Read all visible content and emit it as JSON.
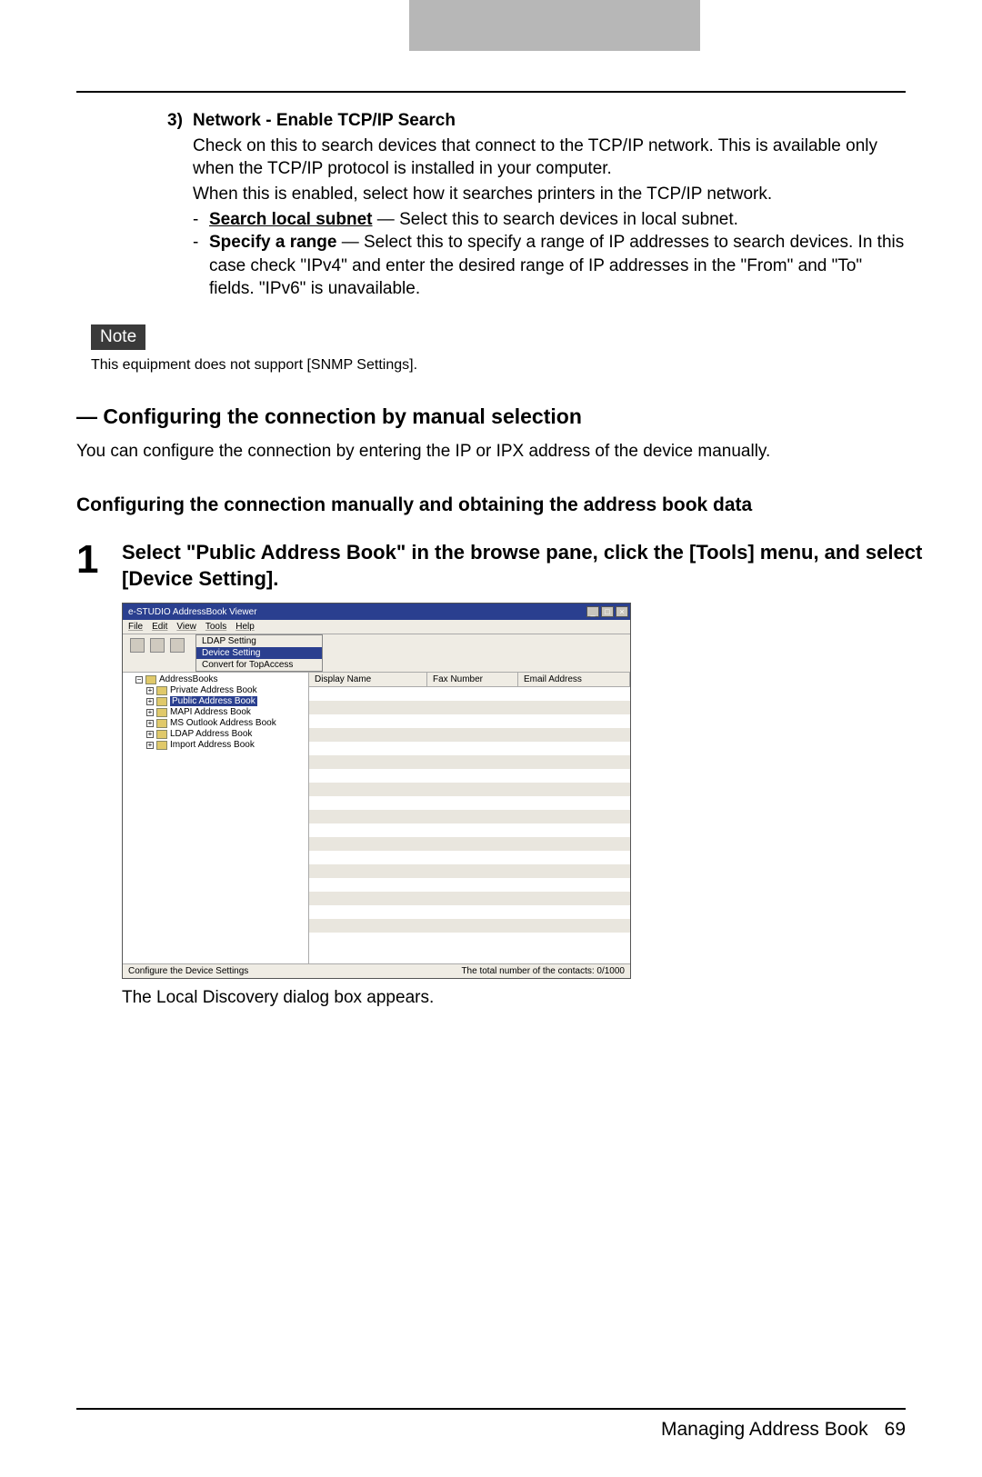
{
  "section3": {
    "num": "3)",
    "title": "Network - Enable TCP/IP Search",
    "body1": "Check on this to search devices that connect to the TCP/IP network. This is available only when the TCP/IP protocol is installed in your computer.",
    "body2": "When this is enabled, select how it searches printers in the TCP/IP network.",
    "bullet1_term": "Search local subnet",
    "bullet1_rest": " — Select this to search devices in local subnet.",
    "bullet2_term": "Specify a range",
    "bullet2_rest": " — Select this to specify a range of IP addresses to search devices. In this case check \"IPv4\" and enter the desired range of IP addresses in the \"From\" and \"To\" fields. \"IPv6\" is unavailable."
  },
  "note": {
    "label": "Note",
    "text": "This equipment does not support [SNMP Settings]."
  },
  "h2": "— Configuring the connection by manual selection",
  "intro": "You can configure the connection by entering the IP or IPX address of the device manually.",
  "h3": "Configuring the connection manually and obtaining the address book data",
  "step1": {
    "num": "1",
    "text": "Select \"Public Address Book\" in the browse pane, click the [Tools] menu, and select [Device Setting]."
  },
  "screenshot": {
    "title": "e-STUDIO AddressBook Viewer",
    "menubar": [
      "File",
      "Edit",
      "View",
      "Tools",
      "Help"
    ],
    "dropdown": [
      "LDAP Setting",
      "Device Setting",
      "Convert for TopAccess"
    ],
    "tree_root_label": "AddressBooks",
    "tree": [
      "Private Address Book",
      "Public Address Book",
      "MAPI Address Book",
      "MS Outlook Address Book",
      "LDAP Address Book",
      "Import Address Book"
    ],
    "selected_tree_index": 1,
    "columns": [
      "Display Name",
      "Fax Number",
      "Email Address"
    ],
    "status_left": "Configure the Device Settings",
    "status_right": "The total number of the contacts: 0/1000"
  },
  "caption": "The Local Discovery dialog box appears.",
  "footer": {
    "title": "Managing Address Book",
    "page": "69"
  }
}
